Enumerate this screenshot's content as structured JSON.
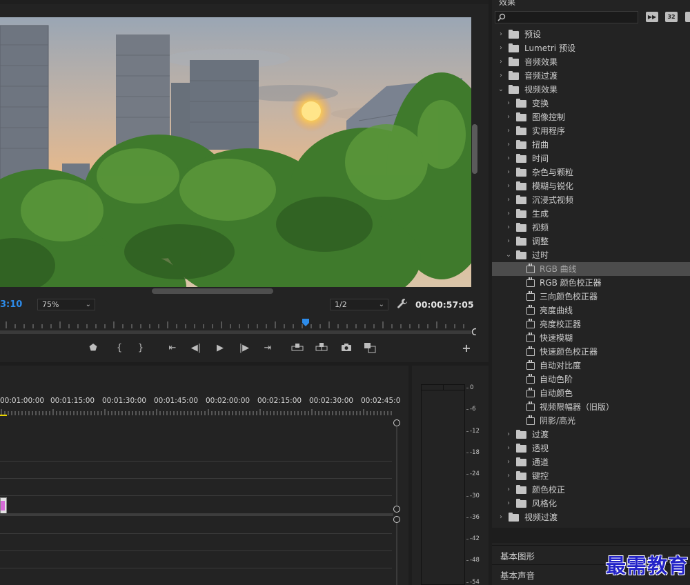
{
  "monitor": {
    "timecode_current": "3:10",
    "zoom": "75%",
    "resolution": "1/2",
    "timecode_duration": "00:00:57:05",
    "controls": [
      "add-marker",
      "mark-in",
      "mark-out",
      "go-to-in",
      "step-back",
      "play",
      "step-forward",
      "go-to-out",
      "lift",
      "extract",
      "export-frame",
      "compare",
      "button-editor"
    ]
  },
  "timeline": {
    "times": [
      "00:01:00:00",
      "00:01:15:00",
      "00:01:30:00",
      "00:01:45:00",
      "00:02:00:00",
      "00:02:15:00",
      "00:02:30:00",
      "00:02:45:0"
    ]
  },
  "meter": {
    "db_labels": [
      "0",
      "-6",
      "-12",
      "-18",
      "-24",
      "-30",
      "-36",
      "-42",
      "-48",
      "-54"
    ]
  },
  "effects": {
    "title": "效果",
    "tree": [
      {
        "label": "预设",
        "level": 0,
        "type": "folder-star",
        "expanded": false
      },
      {
        "label": "Lumetri 预设",
        "level": 0,
        "type": "folder-star",
        "expanded": false
      },
      {
        "label": "音频效果",
        "level": 0,
        "type": "folder",
        "expanded": false
      },
      {
        "label": "音频过渡",
        "level": 0,
        "type": "folder",
        "expanded": false
      },
      {
        "label": "视频效果",
        "level": 0,
        "type": "folder",
        "expanded": true
      },
      {
        "label": "变换",
        "level": 1,
        "type": "folder",
        "expanded": false
      },
      {
        "label": "图像控制",
        "level": 1,
        "type": "folder",
        "expanded": false
      },
      {
        "label": "实用程序",
        "level": 1,
        "type": "folder",
        "expanded": false
      },
      {
        "label": "扭曲",
        "level": 1,
        "type": "folder",
        "expanded": false
      },
      {
        "label": "时间",
        "level": 1,
        "type": "folder",
        "expanded": false
      },
      {
        "label": "杂色与颗粒",
        "level": 1,
        "type": "folder",
        "expanded": false
      },
      {
        "label": "模糊与锐化",
        "level": 1,
        "type": "folder",
        "expanded": false
      },
      {
        "label": "沉浸式视频",
        "level": 1,
        "type": "folder",
        "expanded": false
      },
      {
        "label": "生成",
        "level": 1,
        "type": "folder",
        "expanded": false
      },
      {
        "label": "视频",
        "level": 1,
        "type": "folder",
        "expanded": false
      },
      {
        "label": "调整",
        "level": 1,
        "type": "folder",
        "expanded": false
      },
      {
        "label": "过时",
        "level": 1,
        "type": "folder",
        "expanded": true
      },
      {
        "label": "RGB 曲线",
        "level": 2,
        "type": "effect",
        "selected": true
      },
      {
        "label": "RGB 颜色校正器",
        "level": 2,
        "type": "effect"
      },
      {
        "label": "三向颜色校正器",
        "level": 2,
        "type": "effect"
      },
      {
        "label": "亮度曲线",
        "level": 2,
        "type": "effect"
      },
      {
        "label": "亮度校正器",
        "level": 2,
        "type": "effect"
      },
      {
        "label": "快速模糊",
        "level": 2,
        "type": "effect"
      },
      {
        "label": "快速颜色校正器",
        "level": 2,
        "type": "effect"
      },
      {
        "label": "自动对比度",
        "level": 2,
        "type": "effect"
      },
      {
        "label": "自动色阶",
        "level": 2,
        "type": "effect"
      },
      {
        "label": "自动颜色",
        "level": 2,
        "type": "effect"
      },
      {
        "label": "视频限幅器（旧版）",
        "level": 2,
        "type": "effect"
      },
      {
        "label": "阴影/高光",
        "level": 2,
        "type": "effect"
      },
      {
        "label": "过渡",
        "level": 1,
        "type": "folder",
        "expanded": false
      },
      {
        "label": "透视",
        "level": 1,
        "type": "folder",
        "expanded": false
      },
      {
        "label": "通道",
        "level": 1,
        "type": "folder",
        "expanded": false
      },
      {
        "label": "键控",
        "level": 1,
        "type": "folder",
        "expanded": false
      },
      {
        "label": "颜色校正",
        "level": 1,
        "type": "folder",
        "expanded": false
      },
      {
        "label": "风格化",
        "level": 1,
        "type": "folder",
        "expanded": false
      },
      {
        "label": "视频过渡",
        "level": 0,
        "type": "folder",
        "expanded": false
      }
    ],
    "toolbar": {
      "icon2": "32"
    }
  },
  "panels": {
    "graphics": "基本图形",
    "audio": "基本声音"
  },
  "watermark": "最需教育",
  "colors": {
    "accent_blue": "#2d8ceb",
    "panel_bg": "#232323",
    "playhead_blue": "#2d8ceb",
    "clip_pink": "#d66ad8"
  }
}
